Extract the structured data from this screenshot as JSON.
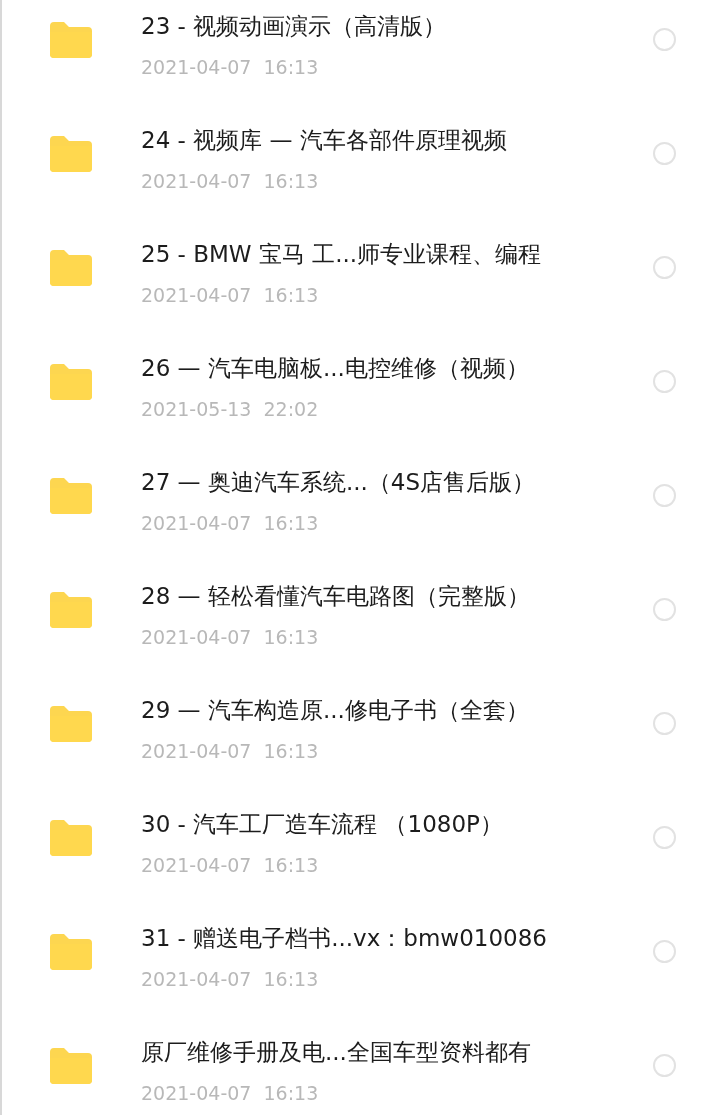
{
  "files": [
    {
      "name": "23 - 视频动画演示（高清版）",
      "date": "2021-04-07  16:13",
      "selected": false
    },
    {
      "name": "24 - 视频库  —  汽车各部件原理视频",
      "date": "2021-04-07  16:13",
      "selected": false
    },
    {
      "name": "25 - BMW 宝马 工...师专业课程、编程",
      "date": "2021-04-07  16:13",
      "selected": false
    },
    {
      "name": "26 —  汽车电脑板...电控维修（视频）",
      "date": "2021-05-13  22:02",
      "selected": false
    },
    {
      "name": "27 —  奥迪汽车系统...（4S店售后版）",
      "date": "2021-04-07  16:13",
      "selected": false
    },
    {
      "name": "28 —  轻松看懂汽车电路图（完整版）",
      "date": "2021-04-07  16:13",
      "selected": false
    },
    {
      "name": "29 —  汽车构造原...修电子书（全套）",
      "date": "2021-04-07  16:13",
      "selected": false
    },
    {
      "name": "30 -   汽车工厂造车流程 （1080P）",
      "date": "2021-04-07  16:13",
      "selected": false
    },
    {
      "name": "31 - 赠送电子档书...vx：bmw010086",
      "date": "2021-04-07  16:13",
      "selected": false
    },
    {
      "name": "原厂维修手册及电...全国车型资料都有",
      "date": "2021-04-07  16:13",
      "selected": false
    }
  ]
}
